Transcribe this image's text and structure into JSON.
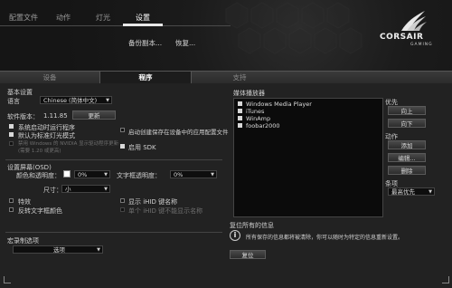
{
  "nav": {
    "items": [
      "配置文件",
      "动作",
      "灯光",
      "设置"
    ],
    "sub_items": [
      "备份副本...",
      "恢复..."
    ]
  },
  "brand": {
    "name": "CORSAIR",
    "sub": "GAMING"
  },
  "tabs": [
    "设备",
    "程序",
    "支持"
  ],
  "basic": {
    "title": "基本设置",
    "language_label": "语言",
    "language_value": "Chinese (简体中文)",
    "version_label": "软件版本：",
    "version_value": "1.11.85",
    "update_btn": "更新",
    "checks": [
      "系统启动时运行程序",
      "默认为标准灯光模式",
      "禁用 Windows 的 NVIDIA 显示驱动程序更新(需要 1.20 或更高)"
    ],
    "check_states": [
      true,
      true,
      false
    ],
    "check_disabled": [
      false,
      false,
      true
    ],
    "auto_profile": "启动创建保存在设备中的应用配置文件",
    "enable_sdk": "启用 SDK"
  },
  "osd": {
    "title": "设置屏幕(OSD)",
    "bg_opacity_label": "颜色和透明度：",
    "bg_opacity_value": "0%",
    "text_opacity_label": "文字框透明度：",
    "text_opacity_value": "0%",
    "size_label": "尺寸：",
    "size_value": "小",
    "checks": [
      "特效",
      "反转文字框颜色"
    ],
    "right_checks": [
      "显示 iHID 键名称",
      "单个 iHID 键不能显示名称"
    ]
  },
  "macro": {
    "title": "宏录制选项",
    "select_value": "选项"
  },
  "media": {
    "title": "媒体播放器",
    "players": [
      "Windows Media Player",
      "iTunes",
      "WinAmp",
      "foobar2000"
    ],
    "priority_label": "优先",
    "up_btn": "向上",
    "down_btn": "向下",
    "action_label": "动作",
    "add_btn": "添加",
    "edit_btn": "编辑...",
    "delete_btn": "删除",
    "order_label": "条项",
    "order_value": "最高优先"
  },
  "reset": {
    "title": "复位所有的信息",
    "desc": "所有保存的信息都将被清除，你可以随时为特定的信息重新设置。",
    "btn": "复位"
  }
}
